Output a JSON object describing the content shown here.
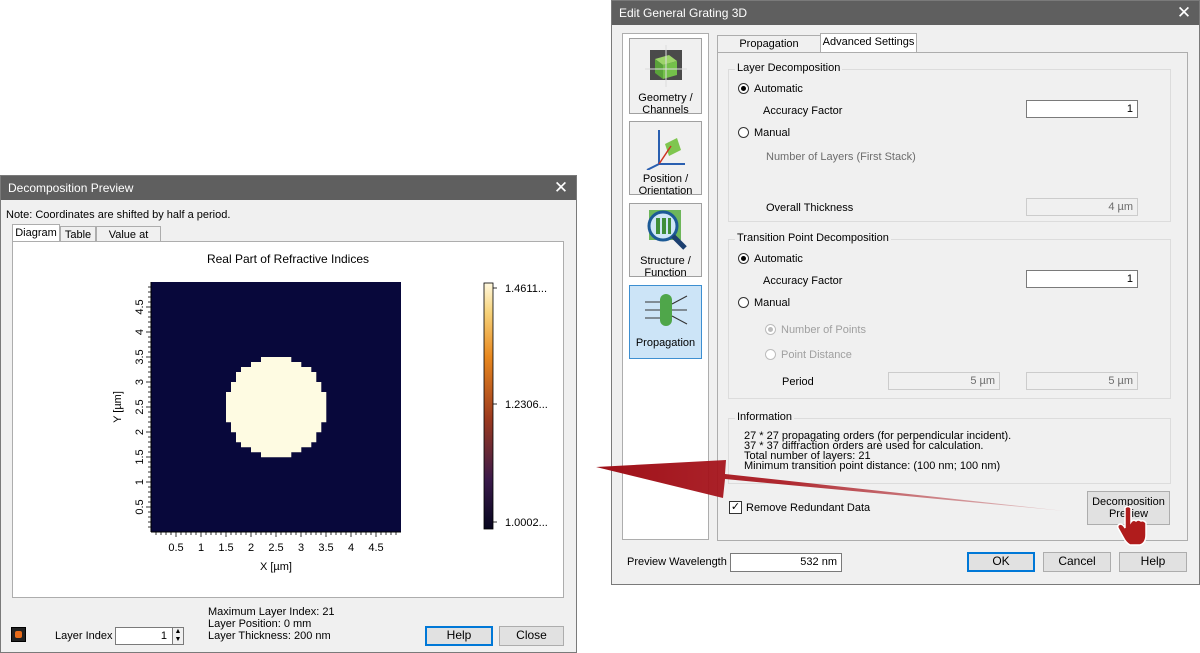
{
  "left_dialog": {
    "title": "Decomposition Preview",
    "note": "Note: Coordinates are shifted by half a period.",
    "tabs": [
      "Diagram",
      "Table",
      "Value at (x,y)"
    ],
    "layer_index_label": "Layer Index",
    "layer_index_value": "1",
    "info_lines": [
      "Maximum Layer Index: 21",
      "Layer Position: 0 mm",
      "Layer Thickness: 200 nm"
    ],
    "help_label": "Help",
    "close_label": "Close"
  },
  "chart_data": {
    "type": "heatmap",
    "title": "Real Part of Refractive Indices",
    "xlabel": "X [µm]",
    "ylabel": "Y [µm]",
    "xlim": [
      0,
      5
    ],
    "ylim": [
      0,
      5
    ],
    "x_ticks": [
      "0.5",
      "1",
      "1.5",
      "2",
      "2.5",
      "3",
      "3.5",
      "4",
      "4.5"
    ],
    "y_ticks": [
      "0.5",
      "1",
      "1.5",
      "2",
      "2.5",
      "3",
      "3.5",
      "4",
      "4.5"
    ],
    "colorbar_labels": [
      "1.4611...",
      "1.2306...",
      "1.0002..."
    ],
    "colors": {
      "background": "#08083b",
      "inclusion": "#fefbe2"
    },
    "shape": {
      "kind": "pixelated-circle",
      "center": [
        2.5,
        2.5
      ],
      "radius": 1.0,
      "grid": 50
    }
  },
  "right_dialog": {
    "title": "Edit General Grating 3D",
    "nav": [
      {
        "label": "Geometry / Channels",
        "icon": "geometry-cube-icon"
      },
      {
        "label": "Position / Orientation",
        "icon": "axes-orientation-icon"
      },
      {
        "label": "Structure / Function",
        "icon": "structure-magnifier-icon"
      },
      {
        "label": "Propagation",
        "icon": "propagation-icon"
      }
    ],
    "tabs": [
      "Propagation Methods",
      "Advanced Settings"
    ],
    "layer_decomposition": {
      "title": "Layer Decomposition",
      "automatic": "Automatic",
      "accuracy_label": "Accuracy Factor",
      "accuracy_value": "1",
      "manual": "Manual",
      "num_layers": "Number of Layers (First Stack)",
      "overall_label": "Overall Thickness",
      "overall_value": "4 µm"
    },
    "transition": {
      "title": "Transition Point Decomposition",
      "automatic": "Automatic",
      "accuracy_label": "Accuracy Factor",
      "accuracy_value": "1",
      "manual": "Manual",
      "num_points": "Number of Points",
      "point_distance": "Point Distance",
      "period_label": "Period",
      "period_x": "5 µm",
      "period_y": "5 µm"
    },
    "information": {
      "title": "Information",
      "lines": [
        "27 * 27 propagating orders (for perpendicular incident).",
        "37 * 37 diffraction orders are used for calculation.",
        "Total number of layers: 21",
        "Minimum transition point distance: (100 nm; 100 nm)"
      ]
    },
    "remove_redundant": "Remove Redundant Data",
    "decomp_preview": [
      "Decomposition",
      "Preview"
    ],
    "preview_wavelength_label": "Preview Wavelength",
    "preview_wavelength_value": "532 nm",
    "ok": "OK",
    "cancel": "Cancel",
    "help": "Help"
  }
}
